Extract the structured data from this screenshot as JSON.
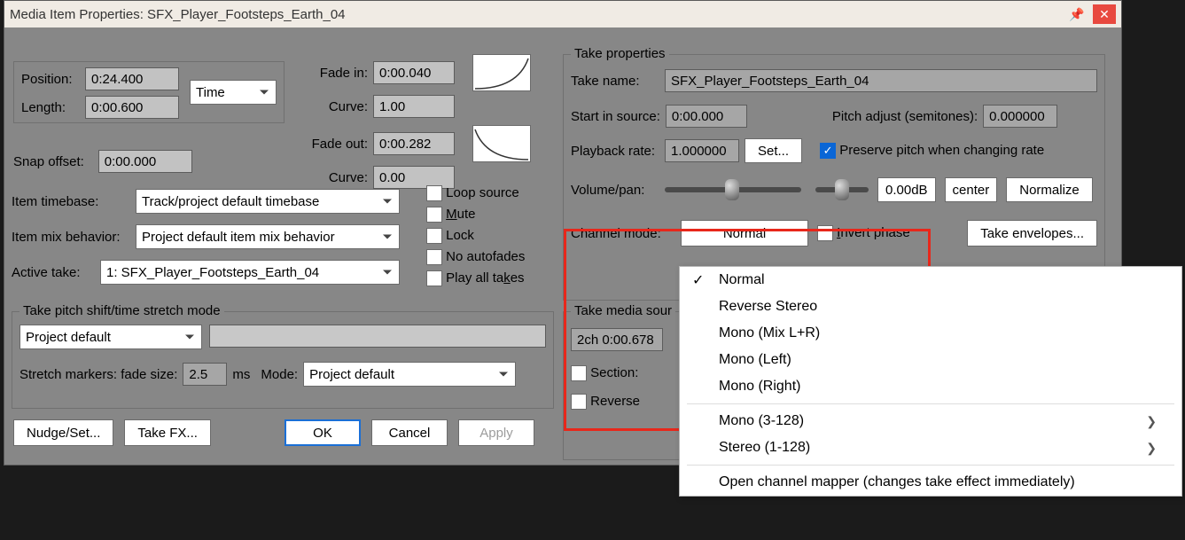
{
  "window_title": "Media Item Properties:  SFX_Player_Footsteps_Earth_04",
  "position": {
    "label": "Position:",
    "value": "0:24.400"
  },
  "length": {
    "label": "Length:",
    "value": "0:00.600"
  },
  "time_mode": "Time",
  "fade_in": {
    "label": "Fade in:",
    "value": "0:00.040",
    "curve_label": "Curve:",
    "curve_value": "1.00"
  },
  "fade_out": {
    "label": "Fade out:",
    "value": "0:00.282",
    "curve_label": "Curve:",
    "curve_value": "0.00"
  },
  "snap_offset": {
    "label": "Snap offset:",
    "value": "0:00.000"
  },
  "item_timebase": {
    "label": "Item timebase:",
    "value": "Track/project default timebase"
  },
  "item_mix": {
    "label": "Item mix behavior:",
    "value": "Project default item mix behavior"
  },
  "active_take": {
    "label": "Active take:",
    "value": "1: SFX_Player_Footsteps_Earth_04"
  },
  "checks": {
    "loop_source": "Loop source",
    "mute": "Mute",
    "lock": "Lock",
    "no_autofades": "No autofades",
    "play_all_takes": "Play all takes"
  },
  "pitch_group": {
    "title": "Take pitch shift/time stretch mode",
    "mode_value": "Project default",
    "stretch_label": "Stretch markers: fade size:",
    "stretch_value": "2.5",
    "ms_label": "ms",
    "mode_label": "Mode:",
    "mode2_value": "Project default"
  },
  "buttons": {
    "nudge": "Nudge/Set...",
    "takefx": "Take FX...",
    "ok": "OK",
    "cancel": "Cancel",
    "apply": "Apply"
  },
  "take_props": {
    "title": "Take properties",
    "take_name_label": "Take name:",
    "take_name_value": "SFX_Player_Footsteps_Earth_04",
    "start_label": "Start in source:",
    "start_value": "0:00.000",
    "pitch_adj_label": "Pitch adjust (semitones):",
    "pitch_adj_value": "0.000000",
    "rate_label": "Playback rate:",
    "rate_value": "1.000000",
    "set_btn": "Set...",
    "preserve_label": "Preserve pitch when changing rate",
    "volpan_label": "Volume/pan:",
    "db_value": "0.00dB",
    "center_value": "center",
    "normalize": "Normalize",
    "channel_label": "Channel mode:",
    "channel_value": "Normal",
    "invert_label": "Invert phase",
    "envelopes": "Take envelopes..."
  },
  "media_source": {
    "title": "Take media sour",
    "summary": "2ch 0:00.678",
    "section": "Section:",
    "reverse": "Reverse"
  },
  "dropdown": {
    "normal": "Normal",
    "reverse_stereo": "Reverse Stereo",
    "mono_mix": "Mono (Mix L+R)",
    "mono_left": "Mono (Left)",
    "mono_right": "Mono (Right)",
    "mono_3_128": "Mono (3-128)",
    "stereo_1_128": "Stereo (1-128)",
    "open_mapper": "Open channel mapper (changes take effect immediately)"
  }
}
